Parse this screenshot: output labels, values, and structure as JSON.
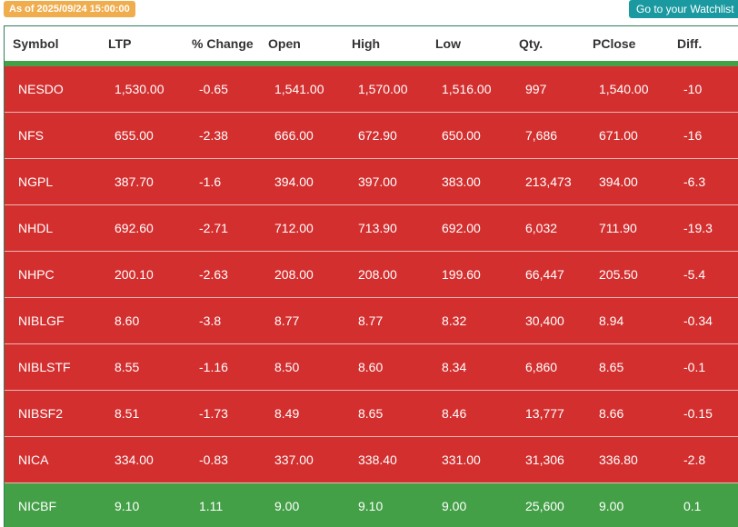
{
  "header_bar": {
    "as_of": "As of 2025/09/24 15:00:00",
    "watchlist_button": "Go to your Watchlist"
  },
  "colors": {
    "down_row": "#d32f2f",
    "up_row": "#43a047",
    "as_of_badge": "#f0ad4e",
    "watchlist_button": "#1a9aa0"
  },
  "table": {
    "columns": [
      "Symbol",
      "LTP",
      "% Change",
      "Open",
      "High",
      "Low",
      "Qty.",
      "PClose",
      "Diff."
    ],
    "rows": [
      {
        "status": "down",
        "cells": [
          "NESDO",
          "1,530.00",
          "-0.65",
          "1,541.00",
          "1,570.00",
          "1,516.00",
          "997",
          "1,540.00",
          "-10"
        ]
      },
      {
        "status": "down",
        "cells": [
          "NFS",
          "655.00",
          "-2.38",
          "666.00",
          "672.90",
          "650.00",
          "7,686",
          "671.00",
          "-16"
        ]
      },
      {
        "status": "down",
        "cells": [
          "NGPL",
          "387.70",
          "-1.6",
          "394.00",
          "397.00",
          "383.00",
          "213,473",
          "394.00",
          "-6.3"
        ]
      },
      {
        "status": "down",
        "cells": [
          "NHDL",
          "692.60",
          "-2.71",
          "712.00",
          "713.90",
          "692.00",
          "6,032",
          "711.90",
          "-19.3"
        ]
      },
      {
        "status": "down",
        "cells": [
          "NHPC",
          "200.10",
          "-2.63",
          "208.00",
          "208.00",
          "199.60",
          "66,447",
          "205.50",
          "-5.4"
        ]
      },
      {
        "status": "down",
        "cells": [
          "NIBLGF",
          "8.60",
          "-3.8",
          "8.77",
          "8.77",
          "8.32",
          "30,400",
          "8.94",
          "-0.34"
        ]
      },
      {
        "status": "down",
        "cells": [
          "NIBLSTF",
          "8.55",
          "-1.16",
          "8.50",
          "8.60",
          "8.34",
          "6,860",
          "8.65",
          "-0.1"
        ]
      },
      {
        "status": "down",
        "cells": [
          "NIBSF2",
          "8.51",
          "-1.73",
          "8.49",
          "8.65",
          "8.46",
          "13,777",
          "8.66",
          "-0.15"
        ]
      },
      {
        "status": "down",
        "cells": [
          "NICA",
          "334.00",
          "-0.83",
          "337.00",
          "338.40",
          "331.00",
          "31,306",
          "336.80",
          "-2.8"
        ]
      },
      {
        "status": "up",
        "cells": [
          "NICBF",
          "9.10",
          "1.11",
          "9.00",
          "9.10",
          "9.00",
          "25,600",
          "9.00",
          "0.1"
        ]
      }
    ]
  }
}
